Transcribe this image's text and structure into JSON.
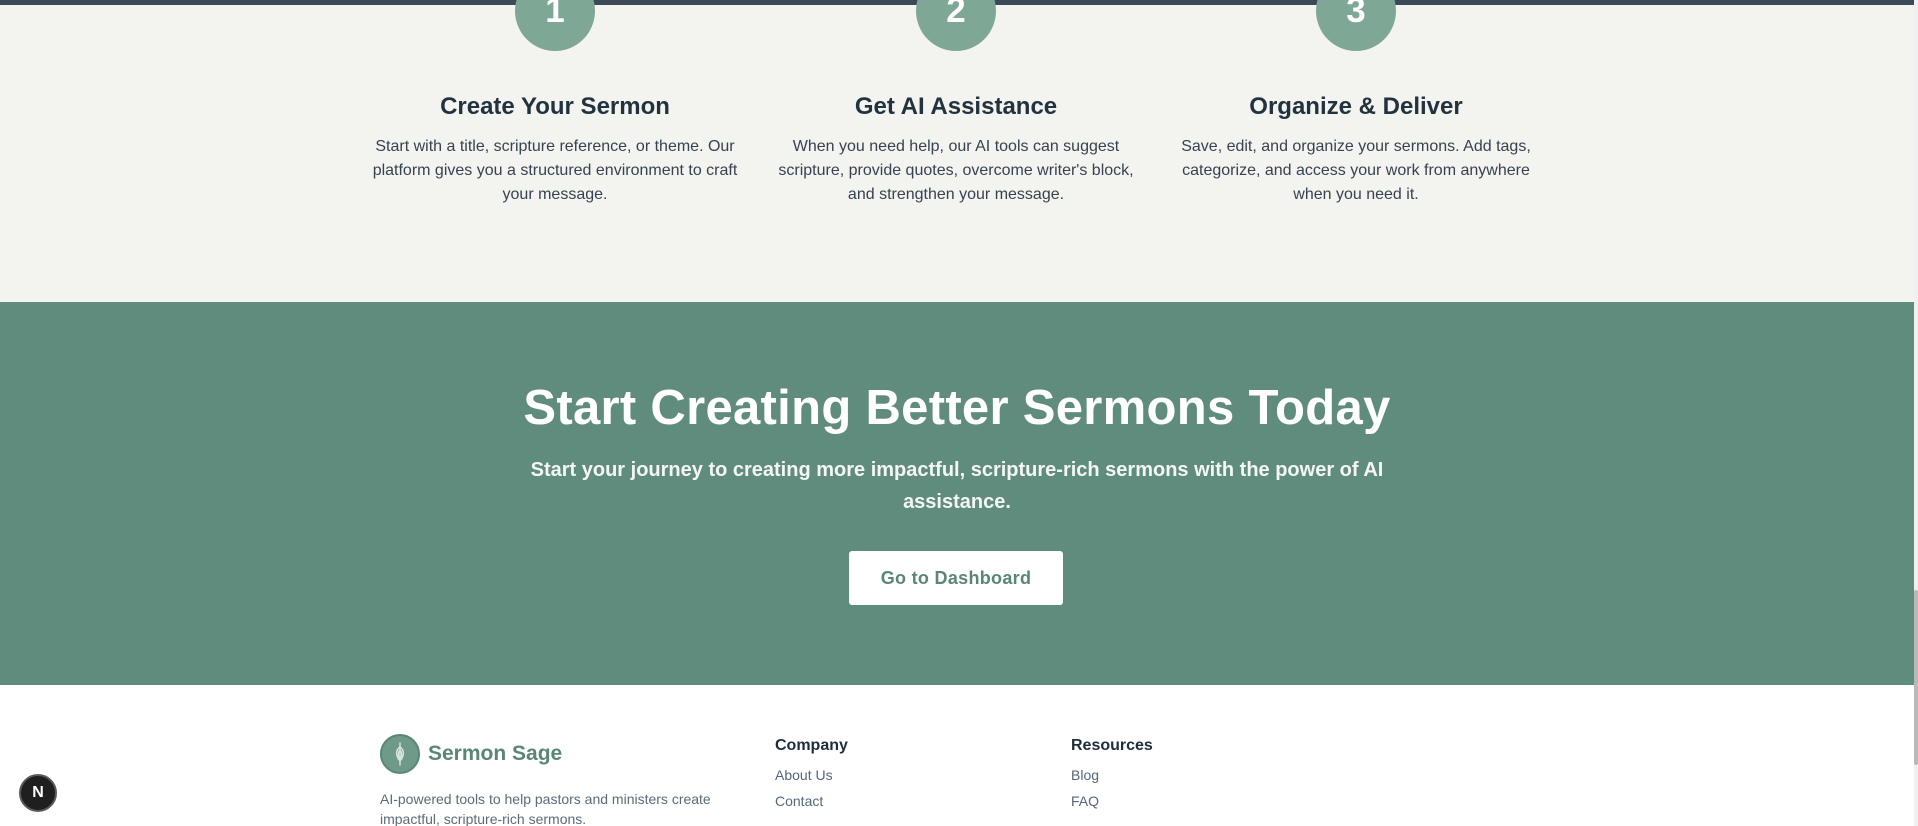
{
  "steps": [
    {
      "number": "1",
      "title": "Create Your Sermon",
      "description": "Start with a title, scripture reference, or theme. Our platform gives you a structured environment to craft your message."
    },
    {
      "number": "2",
      "title": "Get AI Assistance",
      "description": "When you need help, our AI tools can suggest scripture, provide quotes, overcome writer's block, and strengthen your message."
    },
    {
      "number": "3",
      "title": "Organize & Deliver",
      "description": "Save, edit, and organize your sermons. Add tags, categorize, and access your work from anywhere when you need it."
    }
  ],
  "cta": {
    "title": "Start Creating Better Sermons Today",
    "subtitle": "Start your journey to creating more impactful, scripture-rich sermons with the power of AI assistance.",
    "button_label": "Go to Dashboard"
  },
  "footer": {
    "brand_name": "Sermon Sage",
    "brand_description": "AI-powered tools to help pastors and ministers create impactful, scripture-rich sermons.",
    "columns": [
      {
        "title": "Company",
        "links": [
          "About Us",
          "Contact"
        ]
      },
      {
        "title": "Resources",
        "links": [
          "Blog",
          "FAQ"
        ]
      }
    ]
  },
  "dev_badge": {
    "label": "N"
  },
  "colors": {
    "step_circle": "#7ea796",
    "cta_background": "#608c7e",
    "brand_green": "#5a8677",
    "steps_background": "#f3f4ef",
    "heading_dark": "#23323f"
  }
}
